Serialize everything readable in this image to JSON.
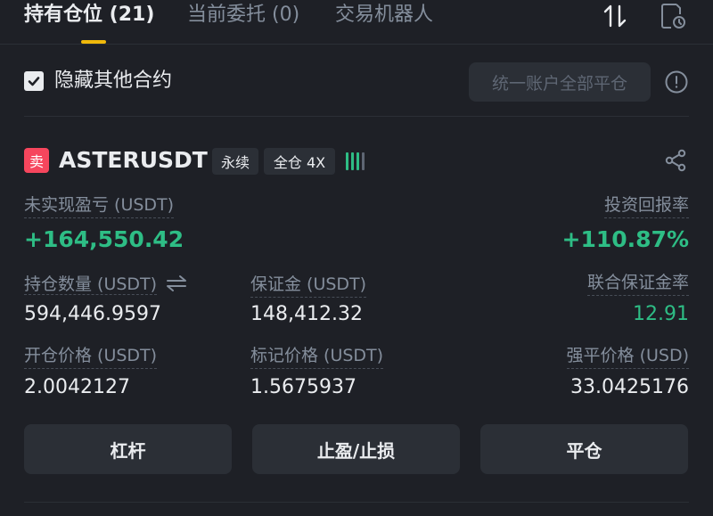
{
  "tabs": [
    {
      "label": "持有仓位 (21)",
      "active": true
    },
    {
      "label": "当前委托 (0)",
      "active": false
    },
    {
      "label": "交易机器人",
      "active": false
    }
  ],
  "filter": {
    "hide_other_label": "隐藏其他合约",
    "checked": true,
    "close_all_label": "统一账户全部平仓"
  },
  "position": {
    "side": "卖",
    "symbol": "ASTERUSDT",
    "contract_type": "永续",
    "margin_mode": "全仓 4X",
    "unrealized_pnl_label": "未实现盈亏 (USDT)",
    "unrealized_pnl": "+164,550.42",
    "roi_label": "投资回报率",
    "roi": "+110.87%",
    "size_label": "持仓数量 (USDT)",
    "size": "594,446.9597",
    "margin_label": "保证金 (USDT)",
    "margin": "148,412.32",
    "margin_ratio_label": "联合保证金率",
    "margin_ratio": "12.91",
    "entry_price_label": "开仓价格 (USDT)",
    "entry_price": "2.0042127",
    "mark_price_label": "标记价格 (USDT)",
    "mark_price": "1.5675937",
    "liq_price_label": "强平价格 (USD)",
    "liq_price": "33.0425176"
  },
  "actions": {
    "leverage": "杠杆",
    "tpsl": "止盈/止损",
    "close": "平仓"
  },
  "colors": {
    "background": "#1e2026",
    "accent": "#f0b90b",
    "profit": "#2ebd85",
    "sell": "#f6465d"
  }
}
